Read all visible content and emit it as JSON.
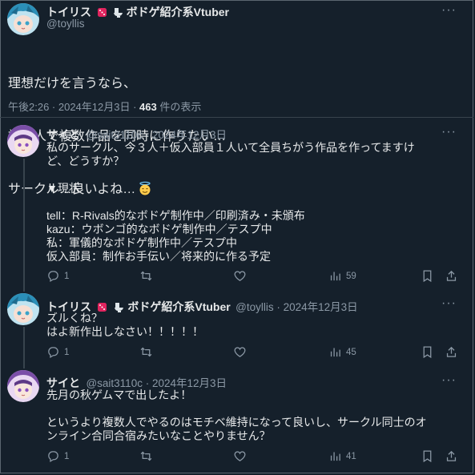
{
  "main_tweet": {
    "display_name": "トイリス",
    "name_suffix": "ボドゲ紹介系Vtuber",
    "handle": "@toyllis",
    "lines": [
      "理想だけを言うなら、",
      "複数人で複数作品を同時に作りたい…",
      "サークル…良いよね…"
    ],
    "time": "午後2:26 · 2024年12月3日 · ",
    "views_count": "463",
    "views_label": " 件の表示"
  },
  "replies": [
    {
      "display_name": "サイと",
      "meta": "@sait3110c · 2024年12月3日",
      "text": "私のサークル、今３人＋仮入部員１人いて全員ちがう作品を作ってますけ\nど、どうすか？\n\n▼現状\n\ntell：R-Rivals的なボドゲ制作中／印刷済み・未頒布\nkazu：ウボンゴ的なボドゲ制作中／テスプ中\n私：軍儀的なボドゲ制作中／テスプ中\n仮入部員：制作お手伝い／将来的に作る予定",
      "stats": {
        "replies": "1",
        "retweets": "",
        "likes": "",
        "views": "59"
      }
    },
    {
      "display_name": "トイリス",
      "name_suffix": "ボドゲ紹介系Vtuber",
      "meta": "@toyllis · 2024年12月3日",
      "text": "ズルくね？\nはよ新作出しなさい！！！！！",
      "stats": {
        "replies": "1",
        "retweets": "",
        "likes": "",
        "views": "45"
      }
    },
    {
      "display_name": "サイと",
      "meta": "@sait3110c · 2024年12月3日",
      "text": "先月の秋ゲムマで出したよ！\n\nというより複数人でやるのはモチベ維持になって良いし、サークル同士のオ\nンライン合同合宿みたいなことやりません？",
      "stats": {
        "replies": "1",
        "retweets": "",
        "likes": "",
        "views": "41"
      }
    }
  ],
  "more_label": "···",
  "colors": {
    "background": "#15202b",
    "text": "#e7e9ea",
    "muted": "#8b98a5",
    "divider": "#38444d"
  }
}
